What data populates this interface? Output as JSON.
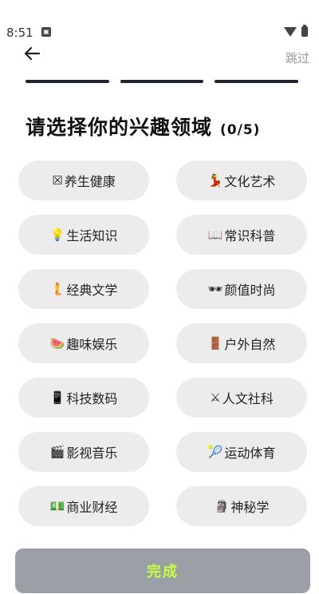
{
  "status": {
    "time": "8:51",
    "notif_icon": "notification-icon"
  },
  "header": {
    "back_icon": "arrow-left-icon",
    "skip_label": "跳过"
  },
  "progress": {
    "steps": 3
  },
  "title": {
    "text": "请选择你的兴趣领域",
    "count": "(0/5)"
  },
  "interests": [
    {
      "emoji": "☒",
      "label": "养生健康"
    },
    {
      "emoji": "💃",
      "label": "文化艺术"
    },
    {
      "emoji": "💡",
      "label": "生活知识"
    },
    {
      "emoji": "📖",
      "label": "常识科普"
    },
    {
      "emoji": "🧜",
      "label": "经典文学"
    },
    {
      "emoji": "🕶",
      "label": "颜值时尚"
    },
    {
      "emoji": "🍉",
      "label": "趣味娱乐"
    },
    {
      "emoji": "🚪",
      "label": "户外自然"
    },
    {
      "emoji": "📱",
      "label": "科技数码"
    },
    {
      "emoji": "⚔",
      "label": "人文社科"
    },
    {
      "emoji": "🎬",
      "label": "影视音乐"
    },
    {
      "emoji": "🎾",
      "label": "运动体育"
    },
    {
      "emoji": "💵",
      "label": "商业财经"
    },
    {
      "emoji": "🗿",
      "label": "神秘学"
    }
  ],
  "footer": {
    "done_label": "完成"
  },
  "colors": {
    "done_bg": "#9aa0a6",
    "done_text": "#c6ff3f",
    "chip_bg": "#ececec",
    "progress": "#1f2430"
  }
}
